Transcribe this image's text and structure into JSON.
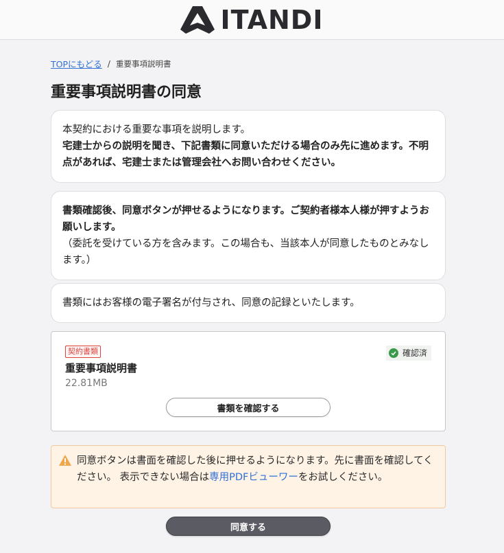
{
  "header": {
    "logo_text": "ITANDI"
  },
  "breadcrumb": {
    "top_link": "TOPにもどる",
    "separator": "/",
    "current": "重要事項説明書"
  },
  "page_title": "重要事項説明書の同意",
  "cards": {
    "intro_line": "本契約における重要な事項を説明します。",
    "intro_bold": "宅建士からの説明を聞き、下記書類に同意いただける場合のみ先に進めます。不明点があれば、宅建士または管理会社へお問い合わせください。",
    "confirm_bold": "書類確認後、同意ボタンが押せるようになります。ご契約者様本人様が押すようお願いします。",
    "confirm_note": "（委託を受けている方を含みます。この場合も、当該本人が同意したものとみなします。）",
    "signature_note": "書類にはお客様の電子署名が付与され、同意の記録といたします。"
  },
  "document": {
    "tag": "契約書類",
    "status": "確認済",
    "name": "重要事項説明書",
    "size": "22.81MB",
    "button_label": "書類を確認する"
  },
  "notice": {
    "text_before": "同意ボタンは書面を確認した後に押せるようになります。先に書面を確認してください。 表示できない場合は",
    "link": "専用PDFビューワー",
    "text_after": "をお試しください。"
  },
  "agree_button_label": "同意する",
  "colors": {
    "link": "#2f6fd6",
    "tag_red": "#d9443a",
    "check_green": "#3a9a4a",
    "notice_bg": "#fff3e6",
    "warning_orange": "#f0a64a",
    "agree_button_bg": "#5b5b63"
  },
  "icons": {
    "logo": "itandi-logo-icon",
    "status": "check-circle-icon",
    "notice": "warning-triangle-icon"
  }
}
